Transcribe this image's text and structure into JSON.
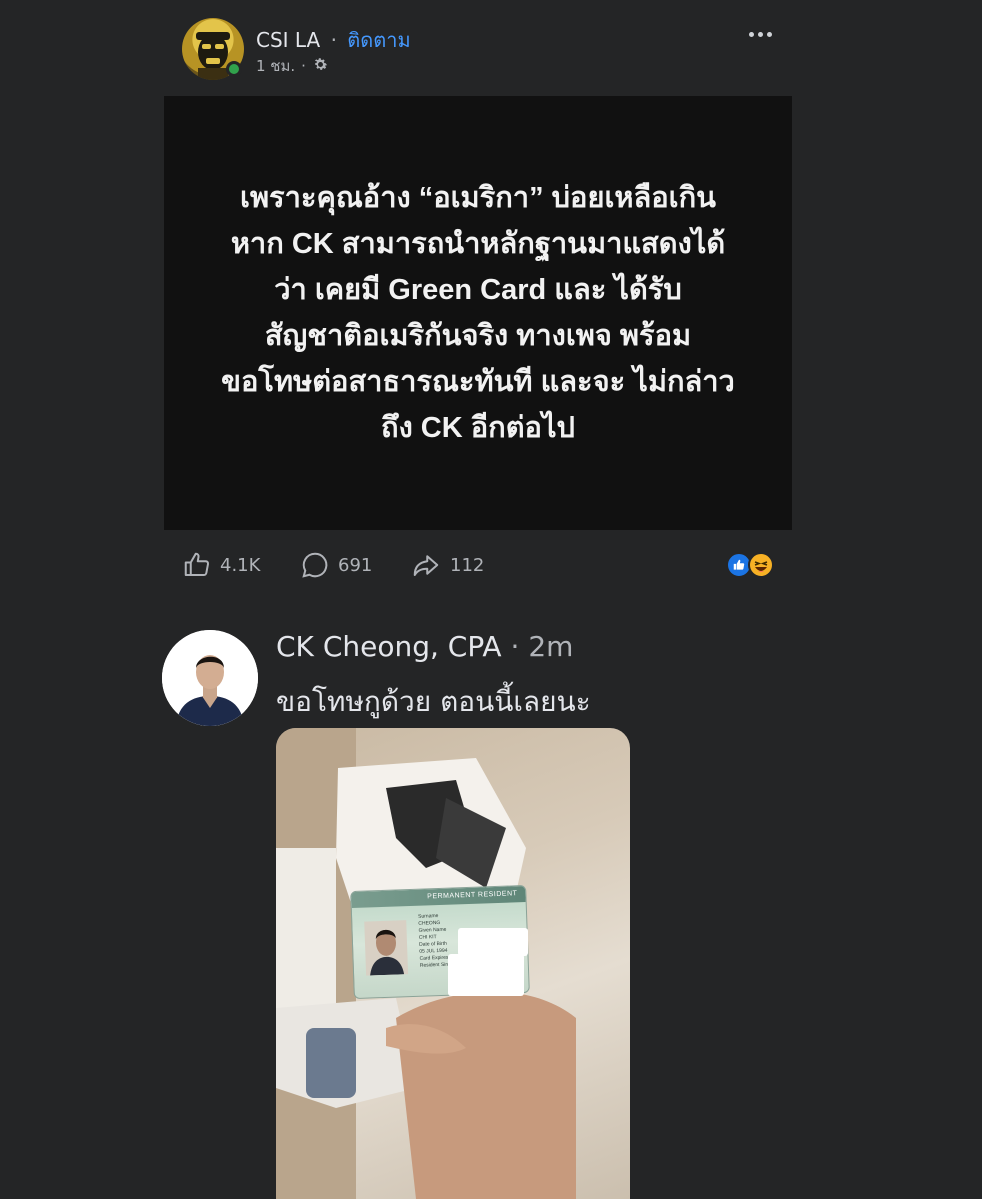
{
  "post": {
    "author": "CSI LA",
    "separator": "·",
    "follow_label": "ติดตาม",
    "time": "1 ชม.",
    "time_separator": "·",
    "audience_icon": "globe-gear-icon",
    "more_icon": "more-options-icon"
  },
  "card": {
    "lines": [
      "เพราะคุณอ้าง “อเมริกา” บ่อยเหลือเกิน",
      "หาก CK สามารถนำหลักฐานมาแสดงได้",
      "ว่า เคยมี Green Card และ ได้รับ",
      "สัญชาติอเมริกันจริง ทางเพจ พร้อม",
      "ขอโทษต่อสาธารณะทันที และจะ ไม่กล่าว",
      "ถึง CK อีกต่อไป"
    ],
    "background": "#111111"
  },
  "actions": {
    "likes": "4.1K",
    "comments": "691",
    "shares": "112",
    "reactions": [
      "like",
      "haha"
    ]
  },
  "comment": {
    "author": "CK Cheong, CPA",
    "separator": "·",
    "time": "2m",
    "text": "ขอโทษกูด้วย ตอนนี้เลยนะ",
    "card_banner": "PERMANENT RESIDENT",
    "card_fields": [
      "Surname",
      "CHEONG",
      "Given Name",
      "CHI KIT",
      "Date of Birth",
      "05 JUL 1994",
      "Card Expires",
      "Resident Since"
    ]
  },
  "colors": {
    "background": "#242526",
    "link": "#4599ff",
    "secondary_text": "#b0b3b8",
    "online": "#31a24c"
  }
}
